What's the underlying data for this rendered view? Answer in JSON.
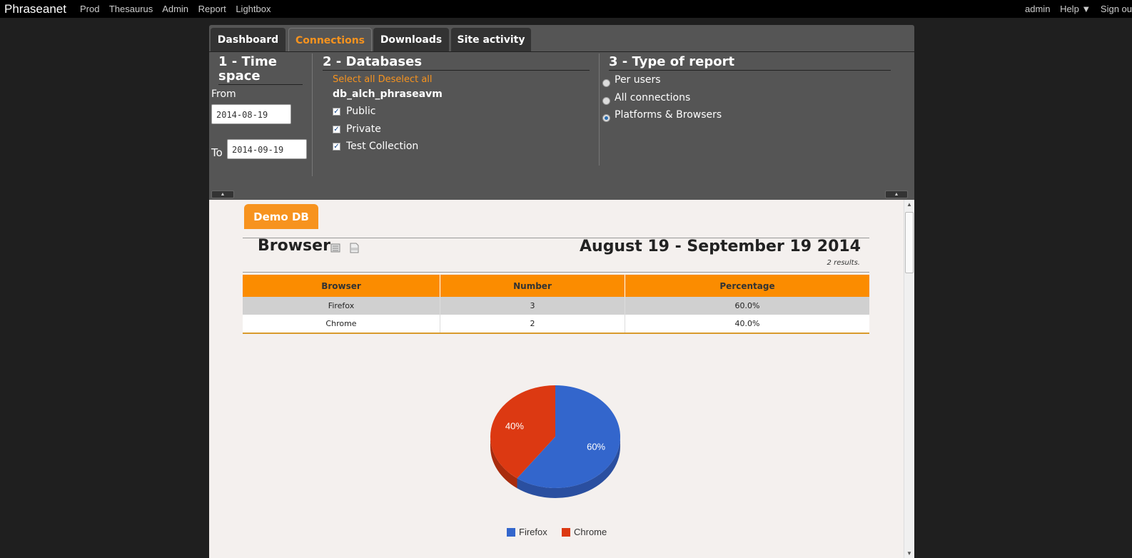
{
  "topbar": {
    "brand": "Phraseanet",
    "nav": [
      "Prod",
      "Thesaurus",
      "Admin",
      "Report",
      "Lightbox"
    ],
    "user": "admin",
    "help": "Help ▼",
    "signout": "Sign ou"
  },
  "tabs": [
    {
      "label": "Dashboard",
      "active": false
    },
    {
      "label": "Connections",
      "active": true
    },
    {
      "label": "Downloads",
      "active": false
    },
    {
      "label": "Site activity",
      "active": false
    }
  ],
  "timespace": {
    "title_line1": "1 - Time",
    "title_line2": "space",
    "from_label": "From",
    "from_value": "2014-08-19",
    "to_label": "To",
    "to_value": "2014-09-19"
  },
  "databases": {
    "title": "2 - Databases",
    "select_all": "Select all",
    "deselect_all": "Deselect all",
    "db_name": "db_alch_phraseavm",
    "collections": [
      "Public",
      "Private",
      "Test Collection"
    ]
  },
  "report_type": {
    "title": "3 - Type of report",
    "options": [
      {
        "label": "Per users",
        "selected": false
      },
      {
        "label": "All connections",
        "selected": false
      },
      {
        "label": "Platforms & Browsers",
        "selected": true
      }
    ]
  },
  "report": {
    "db_tab": "Demo DB",
    "title": "Browser",
    "date_range": "August 19 - September 19 2014",
    "results": "2 results.",
    "columns": [
      "Browser",
      "Number",
      "Percentage"
    ],
    "rows": [
      [
        "Firefox",
        "3",
        "60.0%"
      ],
      [
        "Chrome",
        "2",
        "40.0%"
      ]
    ]
  },
  "colors": {
    "accent": "#f7931e",
    "firefox": "#3366cc",
    "chrome": "#dc3912"
  },
  "chart_data": {
    "type": "pie",
    "categories": [
      "Firefox",
      "Chrome"
    ],
    "values": [
      60,
      40
    ],
    "labels": [
      "60%",
      "40%"
    ],
    "legend": "bottom"
  }
}
